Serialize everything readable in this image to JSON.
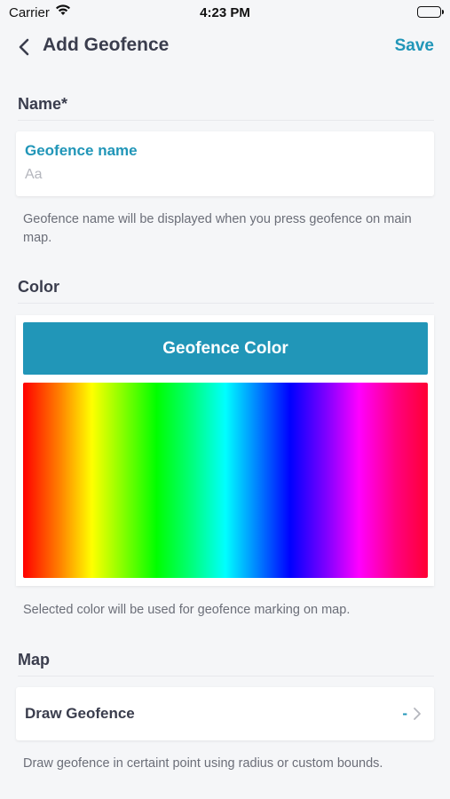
{
  "status_bar": {
    "carrier": "Carrier",
    "time": "4:23 PM"
  },
  "nav": {
    "title": "Add Geofence",
    "save_label": "Save"
  },
  "name_section": {
    "header": "Name*",
    "field_label": "Geofence name",
    "placeholder": "Aa",
    "value": "",
    "helper": "Geofence name will be displayed when you press geofence on main map."
  },
  "color_section": {
    "header": "Color",
    "button_label": "Geofence Color",
    "helper": "Selected color will be used for geofence marking on map.",
    "accent_color": "#2196b8"
  },
  "map_section": {
    "header": "Map",
    "row_label": "Draw Geofence",
    "row_value": "-",
    "helper": "Draw geofence in certaint point using radius or custom bounds."
  },
  "colors": {
    "accent": "#2196b8",
    "text": "#3a3d4d",
    "muted": "#6b6e78",
    "background": "#f5f6f8"
  },
  "icons": [
    "wifi-icon",
    "battery-icon",
    "chevron-left-icon",
    "chevron-right-icon"
  ]
}
